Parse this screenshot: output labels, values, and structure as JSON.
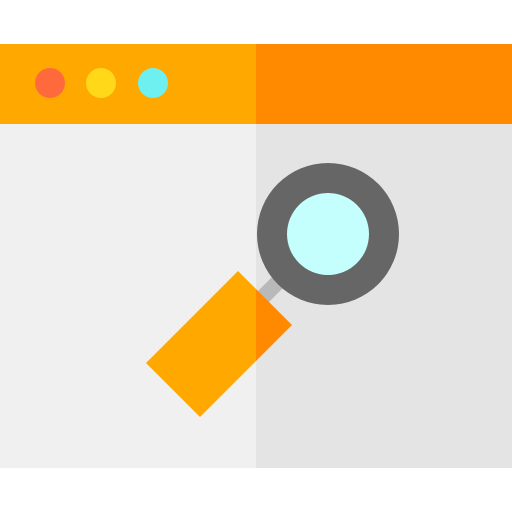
{
  "icon": {
    "name": "browser-search-icon",
    "colors": {
      "titlebar_left": "#FFA800",
      "titlebar_right": "#FF8A00",
      "window_left": "#F0F0F0",
      "window_right": "#E4E4E4",
      "dot_red": "#FF6A3D",
      "dot_yellow": "#FFD81A",
      "dot_cyan": "#6EF0F0",
      "lens_ring": "#666666",
      "lens_glass": "#C4FFFD",
      "neck": "#B9B9B9",
      "handle_left": "#FFA800",
      "handle_right": "#FF8A00"
    }
  }
}
